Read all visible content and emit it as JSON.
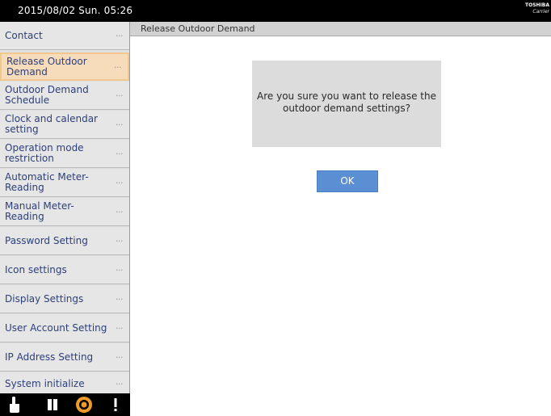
{
  "statusbar": {
    "datetime": "2015/08/02 Sun. 05:26",
    "logo_line1": "TOSHIBA",
    "logo_line2": "Carrier"
  },
  "sidebar": {
    "items": [
      {
        "label": "Contact",
        "active": false
      },
      {
        "label": "Release Outdoor Demand",
        "active": true
      },
      {
        "label": "Outdoor Demand Schedule",
        "active": false
      },
      {
        "label": "Clock and calendar setting",
        "active": false
      },
      {
        "label": "Operation mode restriction",
        "active": false
      },
      {
        "label": "Automatic Meter-Reading",
        "active": false
      },
      {
        "label": "Manual Meter-Reading",
        "active": false
      },
      {
        "label": "Password Setting",
        "active": false
      },
      {
        "label": "Icon settings",
        "active": false
      },
      {
        "label": "Display Settings",
        "active": false
      },
      {
        "label": "User Account Setting",
        "active": false
      },
      {
        "label": "IP Address Setting",
        "active": false
      },
      {
        "label": "System initialize",
        "active": false
      }
    ],
    "more_symbol": "···"
  },
  "bottombar": {
    "icons": [
      "touch-hand-icon",
      "book-icon",
      "settings-gear-icon",
      "alert-exclamation-icon"
    ]
  },
  "header": {
    "title": "Release Outdoor Demand"
  },
  "dialog": {
    "line1": "Are you sure you want to release the",
    "line2": "outdoor demand settings?",
    "ok_label": "OK"
  },
  "colors": {
    "active_item_bg": "#f7dcbc",
    "active_item_border": "#f0c78e",
    "sidebar_text": "#2c3f7a",
    "ok_button": "#5b8fd3",
    "gear_orange": "#f09a2a"
  }
}
